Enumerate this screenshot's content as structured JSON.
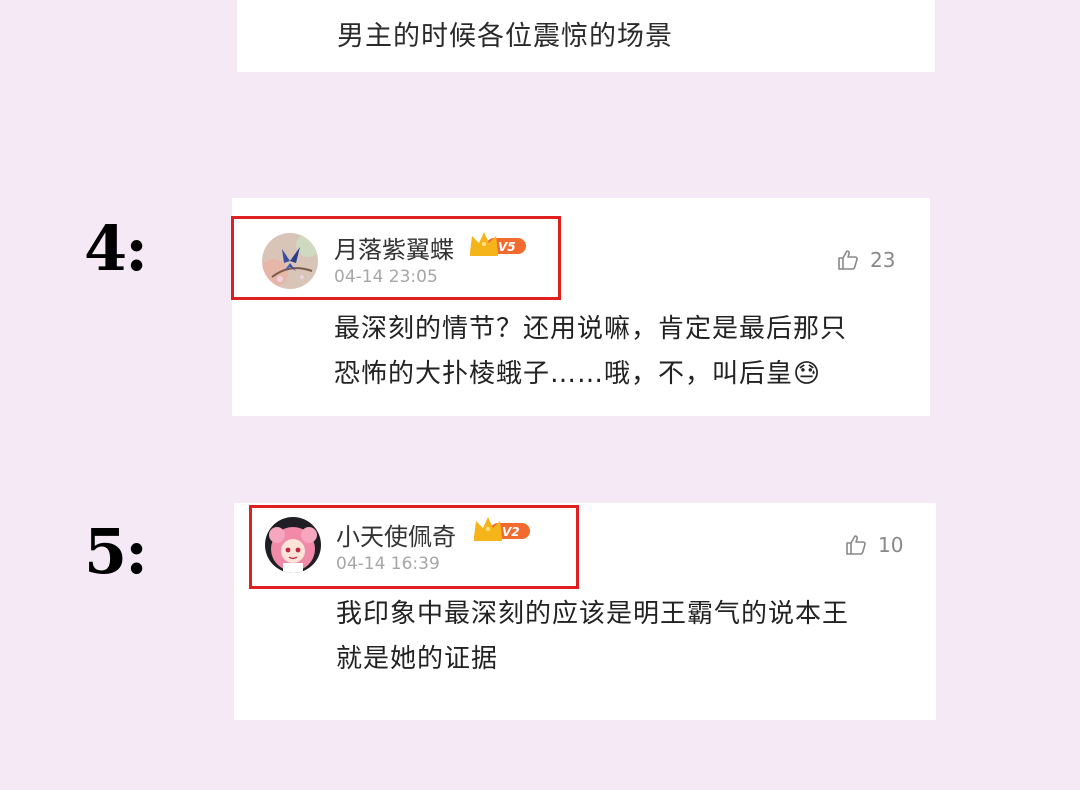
{
  "top_card": {
    "text": "男主的时候各位震惊的场景"
  },
  "entries": [
    {
      "number": "4:",
      "username": "月落紫翼蝶",
      "level_badge": "V5",
      "timestamp": "04-14 23:05",
      "likes": "23",
      "body_lines": [
        "最深刻的情节？还用说嘛，肯定是最后那只",
        "恐怖的大扑棱蛾子……哦，不，叫后皇😓"
      ],
      "avatar_icon": "butterfly-avatar-icon"
    },
    {
      "number": "5:",
      "username": "小天使佩奇",
      "level_badge": "V2",
      "timestamp": "04-14 16:39",
      "likes": "10",
      "body_lines": [
        "我印象中最深刻的应该是明王霸气的说本王",
        "就是她的证据"
      ],
      "avatar_icon": "anime-girl-avatar-icon"
    }
  ],
  "colors": {
    "background": "#f6e9f6",
    "highlight_border": "#e02020",
    "crown_gold": "#f4b41a",
    "badge_orange": "#f26a2e"
  }
}
